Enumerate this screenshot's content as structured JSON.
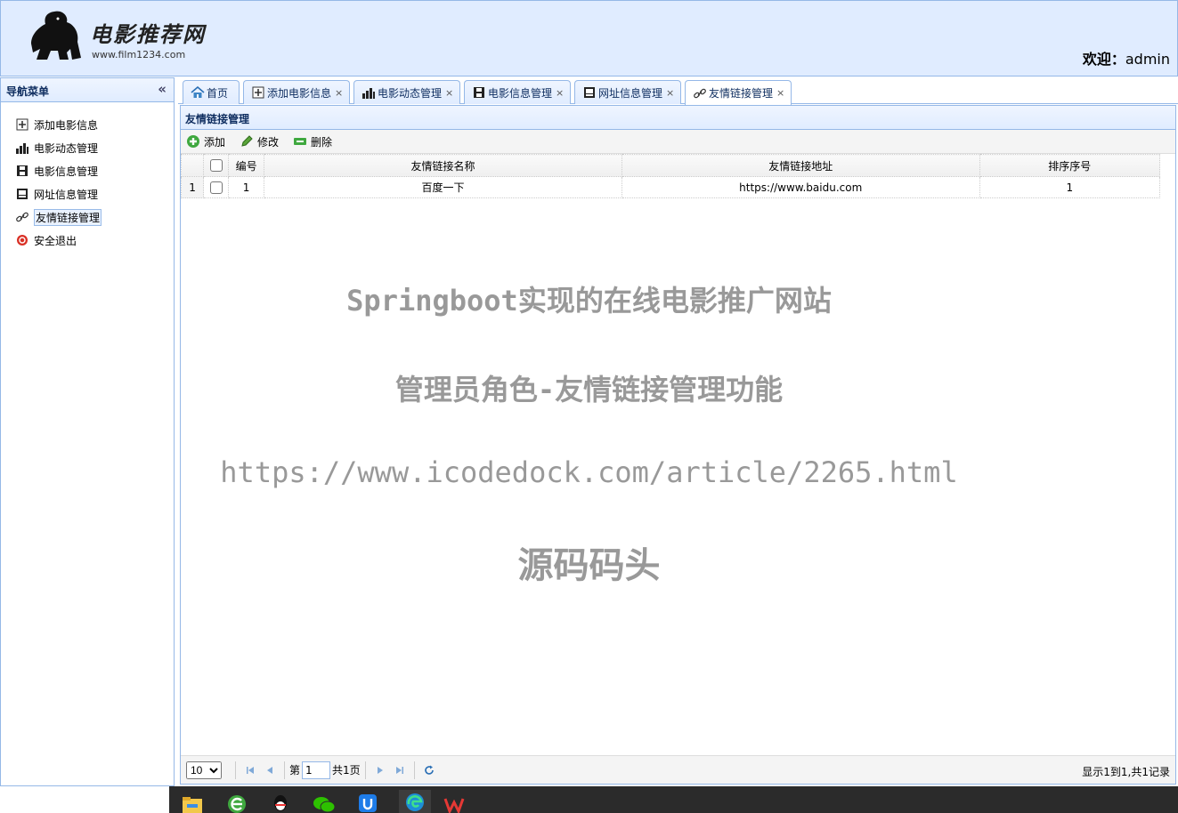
{
  "header": {
    "site_title": "电影推荐网",
    "site_url": "www.film1234.com",
    "welcome_label": "欢迎：",
    "username": "admin"
  },
  "sidebar": {
    "title": "导航菜单",
    "items": [
      {
        "label": "添加电影信息",
        "icon": "add-doc-icon"
      },
      {
        "label": "电影动态管理",
        "icon": "bar-chart-icon"
      },
      {
        "label": "电影信息管理",
        "icon": "film-icon"
      },
      {
        "label": "网址信息管理",
        "icon": "screen-icon"
      },
      {
        "label": "友情链接管理",
        "icon": "link-icon",
        "active": true
      },
      {
        "label": "安全退出",
        "icon": "exit-icon"
      }
    ]
  },
  "tabs": [
    {
      "label": "首页",
      "icon": "home-icon",
      "closable": false
    },
    {
      "label": "添加电影信息",
      "icon": "add-doc-icon",
      "closable": true
    },
    {
      "label": "电影动态管理",
      "icon": "bar-chart-icon",
      "closable": true
    },
    {
      "label": "电影信息管理",
      "icon": "film-icon",
      "closable": true
    },
    {
      "label": "网址信息管理",
      "icon": "screen-icon",
      "closable": true
    },
    {
      "label": "友情链接管理",
      "icon": "link-icon",
      "closable": true,
      "selected": true
    }
  ],
  "tab_close_glyph": "×",
  "panel": {
    "title": "友情链接管理",
    "toolbar": {
      "add": "添加",
      "edit": "修改",
      "delete": "删除"
    },
    "grid": {
      "columns": [
        "编号",
        "友情链接名称",
        "友情链接地址",
        "排序序号"
      ],
      "rows": [
        {
          "row_number": "1",
          "id": "1",
          "name": "百度一下",
          "url": "https://www.baidu.com",
          "order": "1"
        }
      ]
    },
    "pager": {
      "page_size": "10",
      "page_prefix": "第",
      "current_page": "1",
      "total_pages": "共1页",
      "summary": "显示1到1,共1记录"
    }
  },
  "watermark": {
    "line1": "Springboot实现的在线电影推广网站",
    "line2": "管理员角色-友情链接管理功能",
    "line3": "https://www.icodedock.com/article/2265.html",
    "line4": "源码码头"
  },
  "colors": {
    "header_bg": "#e0ecff",
    "border": "#95b8e7",
    "title_text": "#0e2d5f",
    "watermark": "#999999",
    "taskbar": "#2b2b2b"
  }
}
